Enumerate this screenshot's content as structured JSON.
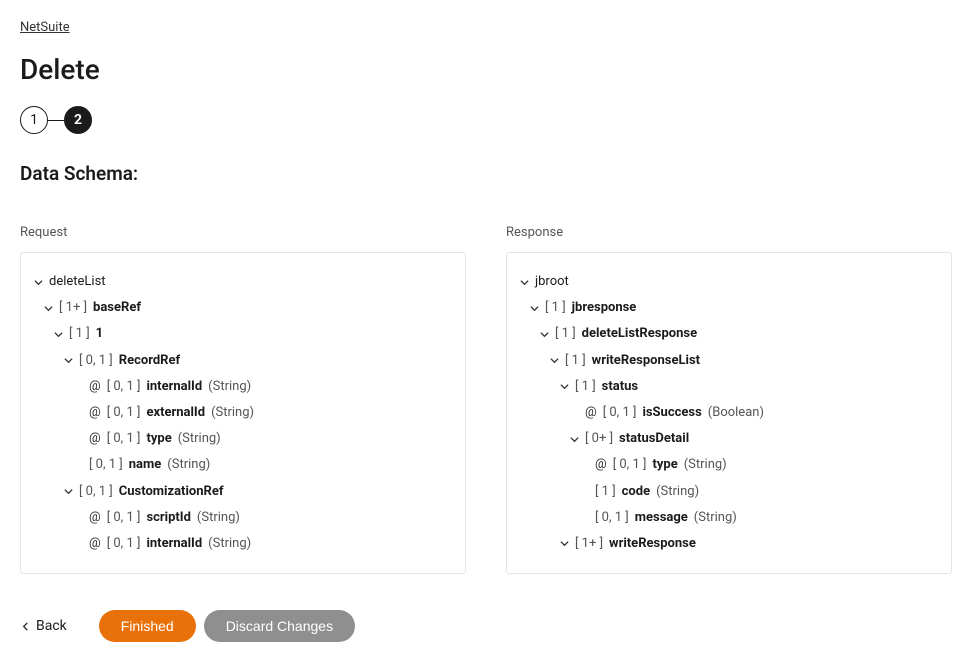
{
  "breadcrumb": {
    "label": "NetSuite"
  },
  "page": {
    "title": "Delete"
  },
  "stepper": {
    "step1": "1",
    "step2": "2"
  },
  "section": {
    "title": "Data Schema:"
  },
  "schema": {
    "request_label": "Request",
    "response_label": "Response",
    "request": {
      "root": "deleteList",
      "baseRef_card": "[ 1+ ]",
      "baseRef": "baseRef",
      "one_card": "[ 1 ]",
      "one": "1",
      "recordRef_card": "[ 0, 1 ]",
      "recordRef": "RecordRef",
      "r_internalId_attr": "@",
      "r_internalId_card": "[ 0, 1 ]",
      "r_internalId": "internalId",
      "r_internalId_type": "(String)",
      "r_externalId_attr": "@",
      "r_externalId_card": "[ 0, 1 ]",
      "r_externalId": "externalId",
      "r_externalId_type": "(String)",
      "r_type_attr": "@",
      "r_type_card": "[ 0, 1 ]",
      "r_type": "type",
      "r_type_type": "(String)",
      "r_name_card": "[ 0, 1 ]",
      "r_name": "name",
      "r_name_type": "(String)",
      "custRef_card": "[ 0, 1 ]",
      "custRef": "CustomizationRef",
      "c_scriptId_attr": "@",
      "c_scriptId_card": "[ 0, 1 ]",
      "c_scriptId": "scriptId",
      "c_scriptId_type": "(String)",
      "c_internalId_attr": "@",
      "c_internalId_card": "[ 0, 1 ]",
      "c_internalId": "internalId",
      "c_internalId_type": "(String)"
    },
    "response": {
      "root": "jbroot",
      "jbresponse_card": "[ 1 ]",
      "jbresponse": "jbresponse",
      "dlr_card": "[ 1 ]",
      "dlr": "deleteListResponse",
      "wrl_card": "[ 1 ]",
      "wrl": "writeResponseList",
      "status_card": "[ 1 ]",
      "status": "status",
      "isSuccess_attr": "@",
      "isSuccess_card": "[ 0, 1 ]",
      "isSuccess": "isSuccess",
      "isSuccess_type": "(Boolean)",
      "statusDetail_card": "[ 0+ ]",
      "statusDetail": "statusDetail",
      "sd_type_attr": "@",
      "sd_type_card": "[ 0, 1 ]",
      "sd_type": "type",
      "sd_type_type": "(String)",
      "sd_code_card": "[ 1 ]",
      "sd_code": "code",
      "sd_code_type": "(String)",
      "sd_message_card": "[ 0, 1 ]",
      "sd_message": "message",
      "sd_message_type": "(String)",
      "wr_card": "[ 1+ ]",
      "wr": "writeResponse"
    }
  },
  "footer": {
    "back": "Back",
    "finished": "Finished",
    "discard": "Discard Changes"
  }
}
